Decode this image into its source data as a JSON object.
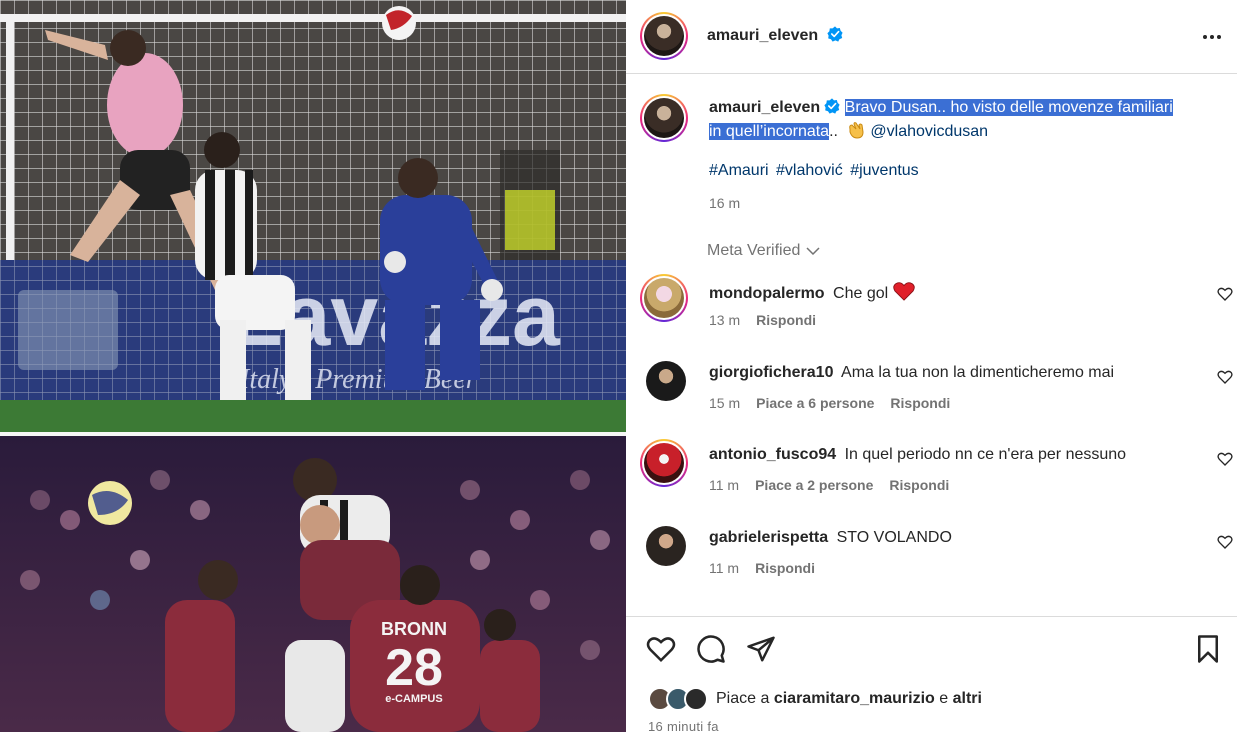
{
  "post": {
    "author": "amauri_eleven",
    "verified": true,
    "caption": {
      "username": "amauri_eleven",
      "text_highlighted_1": "Bravo Dusan.. ho visto delle movenze familiari",
      "text_highlighted_2": "in quell’incornata",
      "text_after": "..",
      "mention": "@vlahovicdusan",
      "hashtags": [
        "#Amauri",
        "#vlahović",
        "#juventus"
      ],
      "time": "16 m"
    },
    "meta_verified_label": "Meta Verified"
  },
  "comments": [
    {
      "username": "mondopalermo",
      "text": "Che gol",
      "time": "13 m",
      "likes": "",
      "reply": "Rispondi",
      "has_heart_emoji": true
    },
    {
      "username": "giorgiofichera10",
      "text": "Ama la tua non la dimenticheremo mai",
      "time": "15 m",
      "likes": "Piace a 6 persone",
      "reply": "Rispondi"
    },
    {
      "username": "antonio_fusco94",
      "text": "In quel periodo nn ce n'era per nessuno",
      "time": "11 m",
      "likes": "Piace a 2 persone",
      "reply": "Rispondi"
    },
    {
      "username": "gabrielerispetta",
      "text": "STO VOLANDO",
      "time": "11 m",
      "likes": "",
      "reply": "Rispondi"
    }
  ],
  "footer": {
    "likes_prefix": "Piace a",
    "liked_by": "ciaramitaro_maurizio",
    "likes_conj": "e",
    "likes_others": "altri",
    "post_time": "16 minuti fa"
  },
  "photo": {
    "ad_board_text": "Lavazza",
    "ad_board_sub": "Italy's Premium Beer",
    "shirt_name": "BRONN",
    "shirt_number": "28",
    "sponsor": "e-CAMPUS"
  },
  "colors": {
    "link": "#00376b",
    "muted": "#737373",
    "highlight": "#3b6fd4",
    "verified": "#0095f6",
    "heart": "#ff3040"
  }
}
